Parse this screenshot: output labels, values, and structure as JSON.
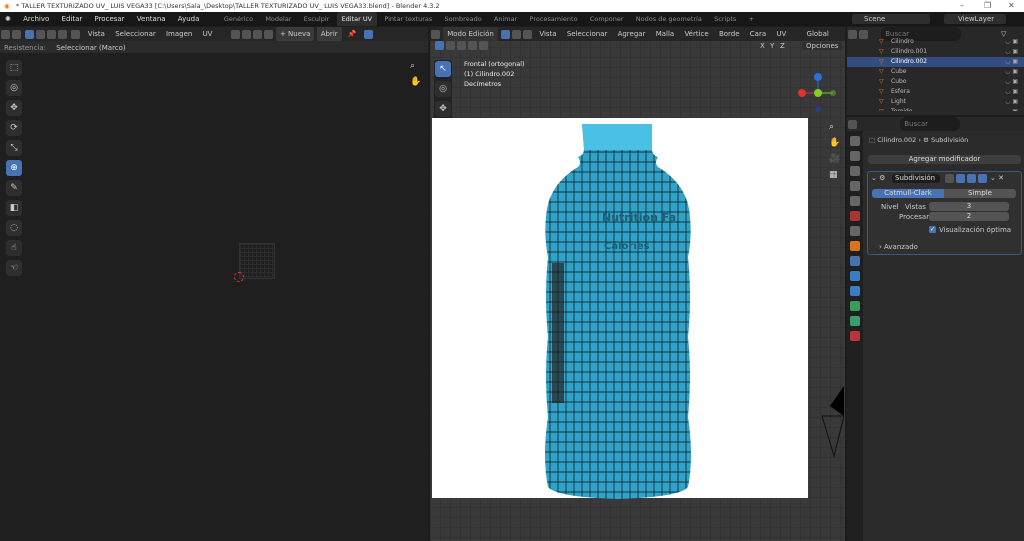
{
  "window": {
    "title": "* TALLER TEXTURIZADO UV_ LUIS VEGA33 [C:\\Users\\Sala_\\Desktop\\TALLER TEXTURIZADO UV_ LUIS VEGA33.blend] - Blender 4.3.2",
    "minimize": "–",
    "maximize": "❐",
    "close": "✕"
  },
  "menu": [
    "Archivo",
    "Editar",
    "Procesar",
    "Ventana",
    "Ayuda"
  ],
  "workspaces": [
    "Genérico",
    "Modelar",
    "Esculpir",
    "Editar UV",
    "Pintar texturas",
    "Sombreado",
    "Animar",
    "Procesamiento",
    "Componer",
    "Nodos de geometría",
    "Scripts",
    "+"
  ],
  "active_workspace": "Editar UV",
  "scene": "Scene",
  "viewlayer": "ViewLayer",
  "uv_editor": {
    "menus": [
      "Vista",
      "Seleccionar",
      "Imagen",
      "UV"
    ],
    "new_label": "+ Nueva",
    "open_label": "Abrir",
    "resistance_label": "Resistencia:",
    "resistance_value": "Seleccionar (Marco)"
  },
  "viewport": {
    "mode": "Modo Edición",
    "menus": [
      "Vista",
      "Seleccionar",
      "Agregar",
      "Malla",
      "Vértice",
      "Borde",
      "Cara",
      "UV"
    ],
    "orientation": "Global",
    "options": "Opciones",
    "axes": [
      "X",
      "Y",
      "Z"
    ],
    "view_name": "Frontal (ortogonal)",
    "object_info": "(1) Cilindro.002",
    "units": "Decímetros",
    "image_text": [
      "Nutrition Fa",
      "Calories"
    ],
    "bottle_color": "#2fa3c9"
  },
  "outliner": {
    "search_placeholder": "Buscar",
    "items": [
      "Cilindro",
      "Cilindro.001",
      "Cilindro.002",
      "Cube",
      "Cubo",
      "Esfera",
      "Light",
      "Toroide"
    ],
    "selected": "Cilindro.002"
  },
  "properties": {
    "search_placeholder": "Buscar",
    "breadcrumb_object": "Cilindro.002",
    "breadcrumb_modifier": "Subdivisión",
    "add_modifier": "Agregar modificador",
    "modifier_name": "Subdivisión",
    "tabs": [
      "Catmull-Clark",
      "Simple"
    ],
    "active_tab": "Catmull-Clark",
    "level_label": "Nivel",
    "viewport_label": "Vistas",
    "viewport_value": "3",
    "render_label": "Procesar",
    "render_value": "2",
    "optimal_label": "Visualización óptima",
    "optimal_checked": true,
    "advanced_label": "Avanzado"
  }
}
